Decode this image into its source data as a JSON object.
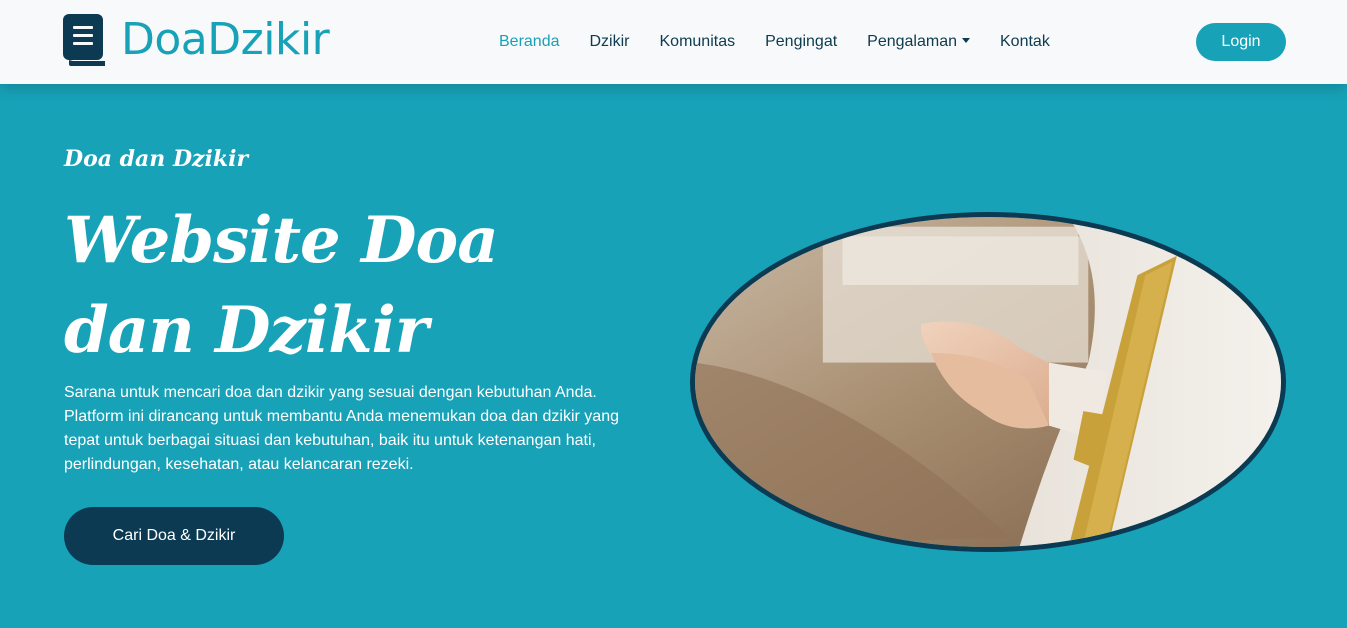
{
  "brand": {
    "name": "DoaDzikir",
    "icon": "book-icon",
    "color": "#17a2b8"
  },
  "nav": {
    "items": [
      {
        "label": "Beranda",
        "active": true
      },
      {
        "label": "Dzikir"
      },
      {
        "label": "Komunitas"
      },
      {
        "label": "Pengingat"
      },
      {
        "label": "Pengalaman",
        "dropdown": true
      },
      {
        "label": "Kontak"
      }
    ],
    "login_label": "Login"
  },
  "hero": {
    "subtitle": "Doa dan Dzikir",
    "title": "Website Doa dan Dzikir",
    "description": "Sarana untuk mencari doa dan dzikir yang sesuai dengan kebutuhan Anda. Platform ini dirancang untuk membantu Anda menemukan doa dan dzikir yang tepat untuk berbagai situasi dan kebutuhan, baik itu untuk ketenangan hati, perlindungan, kesehatan, atau kelancaran rezeki.",
    "cta_label": "Cari Doa & Dzikir"
  },
  "colors": {
    "accent": "#17a2b8",
    "navbar_bg": "#f8f9fa",
    "dark": "#0b3a52",
    "text_dark": "#0d3b4f"
  }
}
